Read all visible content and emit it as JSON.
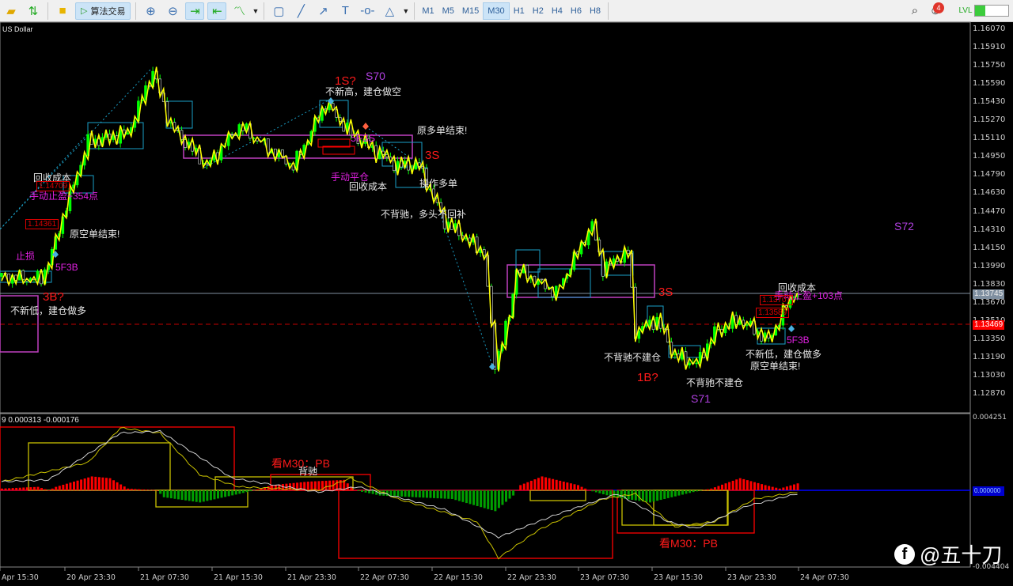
{
  "toolbar": {
    "algo_label": "算法交易",
    "timeframes": [
      "M1",
      "M5",
      "M15",
      "M30",
      "H1",
      "H2",
      "H4",
      "H6",
      "H8"
    ],
    "active_timeframe": "M30",
    "notifications": "4",
    "level_fill": 0.3
  },
  "chart": {
    "symbol": "US Dollar",
    "indicator_label": "9 0.000313 -0.000176",
    "price_axis": [
      "1.16070",
      "1.15910",
      "1.15750",
      "1.15590",
      "1.15430",
      "1.15270",
      "1.15110",
      "1.14950",
      "1.14790",
      "1.14630",
      "1.14470",
      "1.14310",
      "1.14150",
      "1.13990",
      "1.13830",
      "1.13670",
      "1.13510",
      "1.13350",
      "1.13190",
      "1.13030",
      "1.12870"
    ],
    "bid_price": "1.13745",
    "ask_line_price": "1.13469",
    "indicator_axis": {
      "top": "0.004251",
      "zero": "0.000000",
      "bottom": "-0.004404"
    },
    "time_axis": [
      "Apr 15:30",
      "20 Apr 23:30",
      "21 Apr 07:30",
      "21 Apr 15:30",
      "21 Apr 23:30",
      "22 Apr 07:30",
      "22 Apr 15:30",
      "22 Apr 23:30",
      "23 Apr 07:30",
      "23 Apr 15:30",
      "23 Apr 23:30",
      "24 Apr 07:30"
    ]
  },
  "annotations": {
    "a1": "回收成本",
    "a2": "1.14709",
    "a3": "手动止盈+354点",
    "a4": "1.14361",
    "a5": "原空单结束!",
    "a6": "止损",
    "a7": "5F3B",
    "a8": "3B?",
    "a9": "不新低，建仓做多",
    "b1": "1S?",
    "b2": "S70",
    "b3": "不新高，建仓做空",
    "b4": "原多单结束!",
    "b5": "5F3S",
    "b6": "3S",
    "b7": "手动平仓",
    "b8": "回收成本",
    "b9": "操作多单",
    "b10": "不背驰，多头不回补",
    "c1": "S72",
    "c2": "3S",
    "c3": "回收成本",
    "c4": "手动止盈+103点",
    "c5": "1.13707",
    "c6": "1.13589",
    "c7": "5F3B",
    "c8": "不新低，建仓做多",
    "c9": "原空单结束!",
    "c10": "不背驰不建仓",
    "c11": "1B?",
    "c12": "不背驰不建仓",
    "c13": "S71",
    "i1": "看M30：PB",
    "i2": "背驰",
    "i3": "看M30：PB"
  },
  "watermark": "@五十刀",
  "chart_data": {
    "type": "candlestick",
    "ylim": [
      1.1275,
      1.1615
    ],
    "price_keypoints": [
      [
        0,
        1.139
      ],
      [
        11,
        1.1388
      ],
      [
        14,
        1.1411
      ],
      [
        18,
        1.1452
      ],
      [
        24,
        1.1508
      ],
      [
        35,
        1.1515
      ],
      [
        42,
        1.157
      ],
      [
        47,
        1.1522
      ],
      [
        57,
        1.1487
      ],
      [
        66,
        1.1522
      ],
      [
        81,
        1.1487
      ],
      [
        90,
        1.1542
      ],
      [
        97,
        1.1515
      ],
      [
        110,
        1.1487
      ],
      [
        116,
        1.1487
      ],
      [
        123,
        1.1438
      ],
      [
        134,
        1.1411
      ],
      [
        137,
        1.1313
      ],
      [
        141,
        1.1355
      ],
      [
        143,
        1.1397
      ],
      [
        154,
        1.1376
      ],
      [
        164,
        1.1435
      ],
      [
        167,
        1.1397
      ],
      [
        174,
        1.1411
      ],
      [
        176,
        1.1341
      ],
      [
        182,
        1.1352
      ],
      [
        187,
        1.132
      ],
      [
        193,
        1.1313
      ],
      [
        198,
        1.1341
      ],
      [
        205,
        1.1352
      ],
      [
        213,
        1.1334
      ],
      [
        220,
        1.1376
      ]
    ],
    "macd_hist": [
      [
        0,
        0.0001
      ],
      [
        10,
        0.0002
      ],
      [
        13,
        0
      ],
      [
        15,
        0.0002
      ],
      [
        25,
        0.0008
      ],
      [
        30,
        0.0007
      ],
      [
        35,
        0.0001
      ],
      [
        43,
        0
      ],
      [
        45,
        -0.0004
      ],
      [
        55,
        -0.0007
      ],
      [
        66,
        -0.0002
      ],
      [
        70,
        0
      ],
      [
        75,
        0.0003
      ],
      [
        85,
        0.0005
      ],
      [
        95,
        0.0006
      ],
      [
        98,
        0
      ],
      [
        105,
        -0.0003
      ],
      [
        125,
        -0.0005
      ],
      [
        137,
        -0.0012
      ],
      [
        142,
        -0.0003
      ],
      [
        144,
        0.0003
      ],
      [
        150,
        0.0008
      ],
      [
        160,
        0.0003
      ],
      [
        163,
        0
      ],
      [
        170,
        -0.0004
      ],
      [
        180,
        -0.0007
      ],
      [
        192,
        -0.0001
      ],
      [
        197,
        0.0001
      ],
      [
        205,
        0.0007
      ],
      [
        212,
        0.0003
      ],
      [
        216,
        0.0001
      ],
      [
        221,
        0.0004
      ]
    ],
    "signal_yellow": [
      [
        0,
        0.0005
      ],
      [
        24,
        0.0016
      ],
      [
        33,
        0.0036
      ],
      [
        44,
        0.0033
      ],
      [
        55,
        0.0009
      ],
      [
        66,
        0.0002
      ],
      [
        88,
        0
      ],
      [
        97,
        0.0007
      ],
      [
        110,
        -0.0005
      ],
      [
        132,
        -0.0018
      ],
      [
        138,
        -0.0039
      ],
      [
        149,
        -0.0023
      ],
      [
        167,
        -0.0005
      ],
      [
        176,
        -0.0002
      ],
      [
        187,
        -0.0021
      ],
      [
        198,
        -0.0018
      ],
      [
        209,
        -0.0005
      ],
      [
        221,
        -0.0001
      ]
    ],
    "signal_white": [
      [
        0,
        0.0005
      ],
      [
        13,
        0.0006
      ],
      [
        33,
        0.0033
      ],
      [
        44,
        0.0034
      ],
      [
        64,
        0.0007
      ],
      [
        88,
        -0.0001
      ],
      [
        99,
        0.0002
      ],
      [
        123,
        -0.0011
      ],
      [
        138,
        -0.0027
      ],
      [
        154,
        -0.0014
      ],
      [
        171,
        -0.0002
      ],
      [
        185,
        -0.0018
      ],
      [
        193,
        -0.0022
      ],
      [
        207,
        -0.0009
      ],
      [
        221,
        -0.0002
      ]
    ]
  },
  "colors": {
    "bull": "#00ff00",
    "zigzag": "#ffff00",
    "hist_up": "#ff0000",
    "hist_down": "#00a000",
    "box_magenta": "#c040c0",
    "box_cyan": "#1aa0c8",
    "box_red": "#ff0000",
    "box_yellow": "#c8c000"
  }
}
